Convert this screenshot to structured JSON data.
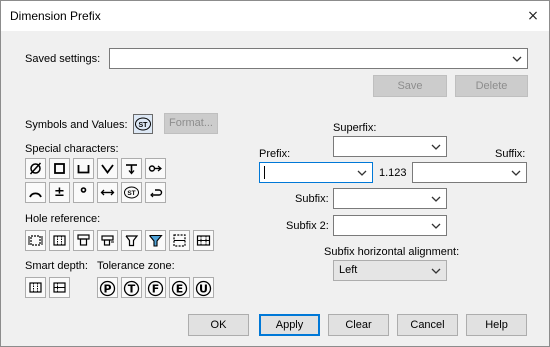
{
  "window": {
    "title": "Dimension Prefix",
    "close_glyph": "×"
  },
  "saved_settings": {
    "label": "Saved settings:",
    "value": "",
    "save_label": "Save",
    "delete_label": "Delete"
  },
  "symbols": {
    "label": "Symbols and Values:",
    "st_button": "ST",
    "format_label": "Format..."
  },
  "special_characters": {
    "label": "Special characters:",
    "row1": [
      "diameter-icon",
      "square-icon",
      "counterbore-icon",
      "countersink-icon",
      "depth-icon",
      "arc-origin-icon"
    ],
    "row2": [
      "arc-length-icon",
      "plus-minus-icon",
      "degree-icon",
      "between-icon",
      "st-icon",
      "return-icon"
    ]
  },
  "hole_reference": {
    "label": "Hole reference:",
    "icons": [
      "hole-ref-1-icon",
      "hole-ref-2-icon",
      "hole-ref-3-icon",
      "hole-ref-4-icon",
      "hole-ref-5-icon",
      "hole-ref-6-icon",
      "hole-ref-7-icon",
      "hole-ref-8-icon"
    ]
  },
  "smart_depth": {
    "label": "Smart depth:",
    "icons": [
      "smart-depth-1-icon",
      "smart-depth-2-icon"
    ]
  },
  "tolerance_zone": {
    "label": "Tolerance zone:",
    "letters": [
      "P",
      "T",
      "F",
      "E",
      "U"
    ]
  },
  "layout_fields": {
    "superfix_label": "Superfix:",
    "superfix_value": "",
    "prefix_label": "Prefix:",
    "prefix_value": "",
    "nominal_value": "1.123",
    "suffix_label": "Suffix:",
    "suffix_value": "",
    "subfix_label": "Subfix:",
    "subfix_value": "",
    "subfix2_label": "Subfix 2:",
    "subfix2_value": "",
    "alignment_label": "Subfix horizontal alignment:",
    "alignment_value": "Left"
  },
  "footer": {
    "ok": "OK",
    "apply": "Apply",
    "clear": "Clear",
    "cancel": "Cancel",
    "help": "Help"
  }
}
